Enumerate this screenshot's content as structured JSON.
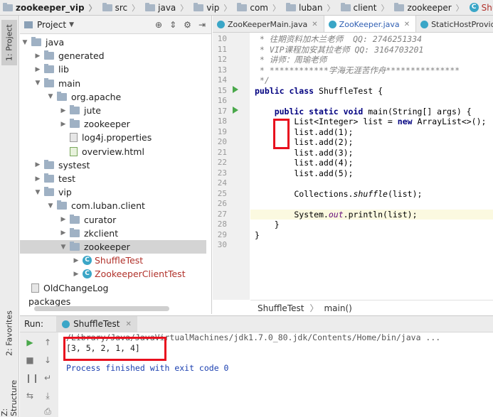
{
  "breadcrumbs": [
    {
      "label": "zookeeper_vip",
      "bold": true
    },
    {
      "label": "src"
    },
    {
      "label": "java"
    },
    {
      "label": "vip"
    },
    {
      "label": "com"
    },
    {
      "label": "luban"
    },
    {
      "label": "client"
    },
    {
      "label": "zookeeper"
    },
    {
      "label": "ShuffleTest",
      "kind": "class"
    }
  ],
  "left_strip": {
    "project_tab": "1: Project",
    "favorites_tab": "2: Favorites",
    "structure_tab": "Z: Structure"
  },
  "project_panel": {
    "title": "Project",
    "tree": [
      {
        "label": "java",
        "depth": 0,
        "type": "folder",
        "arrow": "down"
      },
      {
        "label": "generated",
        "depth": 1,
        "type": "folder",
        "arrow": "right"
      },
      {
        "label": "lib",
        "depth": 1,
        "type": "folder",
        "arrow": "right"
      },
      {
        "label": "main",
        "depth": 1,
        "type": "folder",
        "arrow": "down"
      },
      {
        "label": "org.apache",
        "depth": 2,
        "type": "folder",
        "arrow": "down"
      },
      {
        "label": "jute",
        "depth": 3,
        "type": "folder",
        "arrow": "right"
      },
      {
        "label": "zookeeper",
        "depth": 3,
        "type": "folder",
        "arrow": "right"
      },
      {
        "label": "log4j.properties",
        "depth": 3,
        "type": "file",
        "arrow": ""
      },
      {
        "label": "overview.html",
        "depth": 3,
        "type": "html",
        "arrow": ""
      },
      {
        "label": "systest",
        "depth": 1,
        "type": "folder",
        "arrow": "right"
      },
      {
        "label": "test",
        "depth": 1,
        "type": "folder",
        "arrow": "right"
      },
      {
        "label": "vip",
        "depth": 1,
        "type": "folder",
        "arrow": "down"
      },
      {
        "label": "com.luban.client",
        "depth": 2,
        "type": "folder",
        "arrow": "down"
      },
      {
        "label": "curator",
        "depth": 3,
        "type": "folder",
        "arrow": "right"
      },
      {
        "label": "zkclient",
        "depth": 3,
        "type": "folder",
        "arrow": "right"
      },
      {
        "label": "zookeeper",
        "depth": 3,
        "type": "folder",
        "arrow": "down",
        "selected": true
      },
      {
        "label": "ShuffleTest",
        "depth": 4,
        "type": "class",
        "arrow": "right"
      },
      {
        "label": "ZookeeperClientTest",
        "depth": 4,
        "type": "class",
        "arrow": "right"
      },
      {
        "label": "OldChangeLog",
        "depth": 0,
        "type": "file",
        "arrow": ""
      },
      {
        "label": "packages",
        "depth": -1,
        "type": "text",
        "arrow": ""
      }
    ]
  },
  "editor": {
    "tabs": [
      {
        "label": "ZooKeeperMain.java",
        "active": false,
        "blue": false
      },
      {
        "label": "ZooKeeper.java",
        "active": true,
        "blue": true
      },
      {
        "label": "StaticHostProvider.",
        "active": false,
        "blue": false
      }
    ],
    "line_numbers": [
      "10",
      "11",
      "12",
      "13",
      "14",
      "15",
      "16",
      "17",
      "18",
      "19",
      "20",
      "21",
      "22",
      "23",
      "24",
      "25",
      "26",
      "27",
      "28",
      "29",
      "30"
    ],
    "lines": {
      "l10": " * 往期资料加木兰老师  QQ: 2746251334",
      "l11": " * VIP课程加安其拉老师 QQ: 3164703201",
      "l12": " * 讲师：周瑜老师",
      "l13": " * ************学海无涯苦作舟***************",
      "l14": " */",
      "l15_kw": "public class",
      "l15_rest": " ShuffleTest {",
      "l17_kw": "    public static void",
      "l17_rest": " main(String[] args) {",
      "l18a": "        List<Integer> list = ",
      "l18_kw": "new",
      "l18b": " ArrayList<>();",
      "l19": "        list.add(1);",
      "l20": "        list.add(2);",
      "l21": "        list.add(3);",
      "l22": "        list.add(4);",
      "l23": "        list.add(5);",
      "l25a": "        Collections.",
      "l25_it": "shuffle",
      "l25b": "(list);",
      "l27a": "        System.",
      "l27_it": "out",
      "l27b": ".println(list);",
      "l28": "    }",
      "l29": "}"
    },
    "breadcrumb": {
      "class": "ShuffleTest",
      "method": "main()"
    }
  },
  "run_panel": {
    "label": "Run:",
    "tab": "ShuffleTest",
    "console": {
      "path_line": "/Library/Java/JavaVirtualMachines/jdk1.7.0_80.jdk/Contents/Home/bin/java ...",
      "output_line": "[3, 5, 2, 1, 4]",
      "finish_line": "Process finished with exit code 0"
    }
  },
  "colors": {
    "accent_red": "#e8101e",
    "run_green": "#4aa84b",
    "class_icon": "#3aa6c7"
  }
}
